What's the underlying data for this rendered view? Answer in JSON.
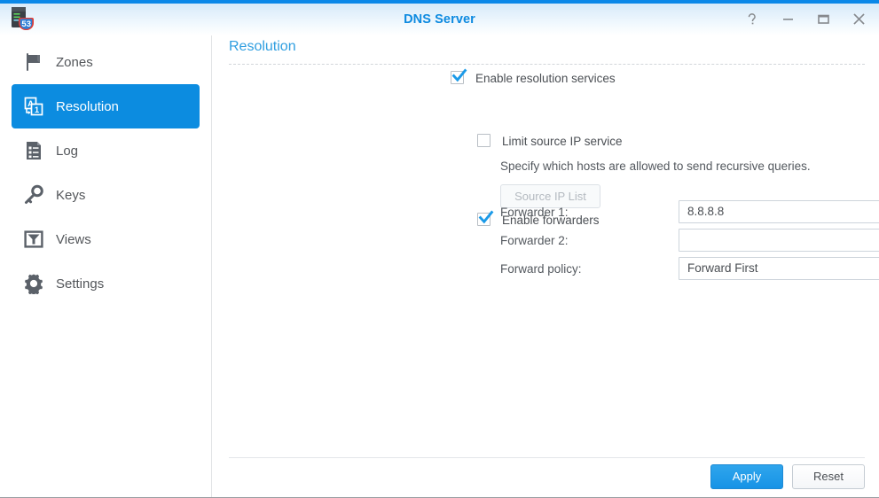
{
  "window": {
    "title": "DNS Server",
    "app_icon": "dns-server-icon",
    "controls": [
      {
        "name": "help-button",
        "glyph": "?"
      },
      {
        "name": "minimize-button",
        "glyph": "—"
      },
      {
        "name": "maximize-button",
        "glyph": "□"
      },
      {
        "name": "close-button",
        "glyph": "✕"
      }
    ]
  },
  "sidebar": {
    "items": [
      {
        "label": "Zones",
        "icon": "flag-icon",
        "active": false
      },
      {
        "label": "Resolution",
        "icon": "resolution-icon",
        "active": true
      },
      {
        "label": "Log",
        "icon": "log-icon",
        "active": false
      },
      {
        "label": "Keys",
        "icon": "key-icon",
        "active": false
      },
      {
        "label": "Views",
        "icon": "views-icon",
        "active": false
      },
      {
        "label": "Settings",
        "icon": "gear-icon",
        "active": false
      }
    ]
  },
  "main": {
    "panel_title": "Resolution",
    "enable_resolution": {
      "label": "Enable resolution services",
      "checked": true
    },
    "limit_source_ip": {
      "label": "Limit source IP service",
      "checked": false
    },
    "hint": "Specify which hosts are allowed to send recursive queries.",
    "source_ip_list_button": {
      "label": "Source IP List",
      "disabled": true
    },
    "enable_forwarders": {
      "label": "Enable forwarders",
      "checked": true
    },
    "fields": {
      "forwarder1_label": "Forwarder 1:",
      "forwarder1_value": "8.8.8.8",
      "forwarder2_label": "Forwarder 2:",
      "forwarder2_value": "",
      "forward_policy_label": "Forward policy:",
      "forward_policy_value": "Forward First"
    }
  },
  "footer": {
    "apply_label": "Apply",
    "reset_label": "Reset"
  },
  "colors": {
    "accent_blue": "#0c8ce0",
    "title_blue": "#0d8ae0",
    "panel_title_blue": "#2f9ee0",
    "text_grey": "#4b4f54",
    "apply_blue": "#1793e6"
  }
}
